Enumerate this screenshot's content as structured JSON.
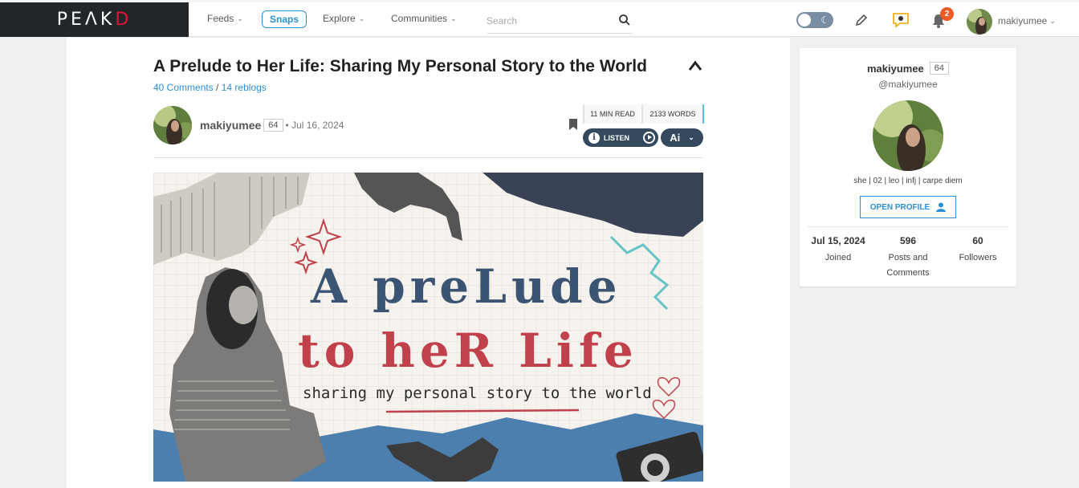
{
  "nav": {
    "logo_left": "PE",
    "logo_mid": "ΛK",
    "logo_right": "D",
    "feeds": "Feeds",
    "snaps": "Snaps",
    "explore": "Explore",
    "communities": "Communities",
    "search_placeholder": "Search",
    "notification_count": "2",
    "username": "makiyumee",
    "icons": [
      "search-icon",
      "moon-icon",
      "pencil-icon",
      "chat-icon",
      "bell-icon",
      "chevron-down-icon"
    ]
  },
  "post": {
    "title": "A Prelude to Her Life: Sharing My Personal Story to the World",
    "comments": "40 Comments",
    "reblogs": "14 reblogs",
    "author": "makiyumee",
    "reputation": "64",
    "date": "• Jul 16, 2024",
    "read_time": "11 MIN READ",
    "words": "2133 WORDS",
    "listen": "LISTEN",
    "ai": "Ai"
  },
  "hero": {
    "line1": "A preLude",
    "line2": "to heR Life",
    "line3": "sharing my personal story to the world"
  },
  "profile": {
    "name": "makiyumee",
    "reputation": "64",
    "handle": "@makiyumee",
    "bio": "she | 02 | leo | infj | carpe diem",
    "open_profile": "OPEN PROFILE",
    "joined_value": "Jul 15, 2024",
    "joined_label": "Joined",
    "posts_value": "596",
    "posts_label": "Posts and Comments",
    "followers_value": "60",
    "followers_label": "Followers"
  },
  "colors": {
    "accent": "#2b8fd6",
    "brand_red": "#e31337",
    "dark_button": "#34495e",
    "badge": "#ee5a24"
  }
}
